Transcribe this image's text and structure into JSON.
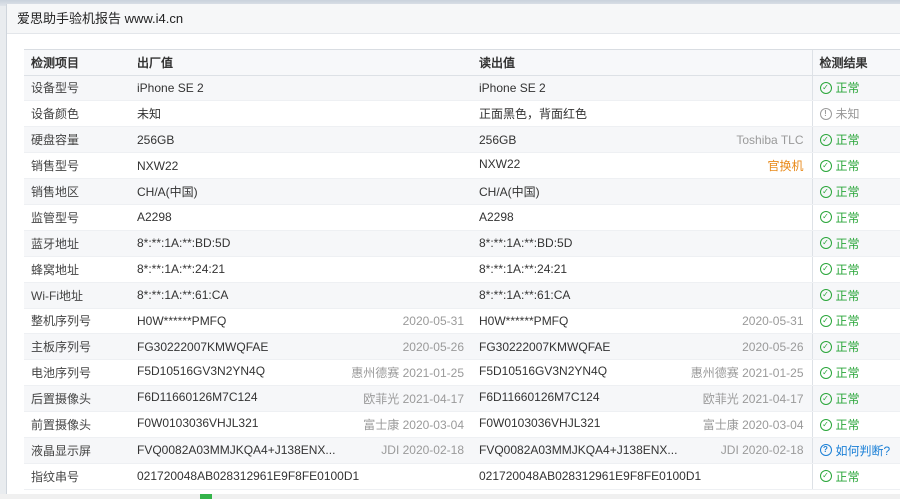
{
  "window": {
    "title": "爱思助手验机报告 www.i4.cn"
  },
  "table": {
    "headers": [
      "检测项目",
      "出厂值",
      "读出值",
      "检测结果"
    ],
    "rows": [
      {
        "item": "设备型号",
        "factory": "iPhone SE 2",
        "factory_note": "",
        "read": "iPhone SE 2",
        "read_note": "",
        "read_note_warn": false,
        "result": "正常",
        "result_type": "ok"
      },
      {
        "item": "设备颜色",
        "factory": "未知",
        "factory_note": "",
        "read": "正面黑色，背面红色",
        "read_note": "",
        "read_note_warn": false,
        "result": "未知",
        "result_type": "unknown"
      },
      {
        "item": "硬盘容量",
        "factory": "256GB",
        "factory_note": "",
        "read": "256GB",
        "read_note": "Toshiba TLC",
        "read_note_warn": false,
        "result": "正常",
        "result_type": "ok"
      },
      {
        "item": "销售型号",
        "factory": "NXW22",
        "factory_note": "",
        "read": "NXW22",
        "read_note": "官换机",
        "read_note_warn": true,
        "result": "正常",
        "result_type": "ok"
      },
      {
        "item": "销售地区",
        "factory": "CH/A(中国)",
        "factory_note": "",
        "read": "CH/A(中国)",
        "read_note": "",
        "read_note_warn": false,
        "result": "正常",
        "result_type": "ok"
      },
      {
        "item": "监管型号",
        "factory": "A2298",
        "factory_note": "",
        "read": "A2298",
        "read_note": "",
        "read_note_warn": false,
        "result": "正常",
        "result_type": "ok"
      },
      {
        "item": "蓝牙地址",
        "factory": "8*:**:1A:**:BD:5D",
        "factory_note": "",
        "read": "8*:**:1A:**:BD:5D",
        "read_note": "",
        "read_note_warn": false,
        "result": "正常",
        "result_type": "ok"
      },
      {
        "item": "蜂窝地址",
        "factory": "8*:**:1A:**:24:21",
        "factory_note": "",
        "read": "8*:**:1A:**:24:21",
        "read_note": "",
        "read_note_warn": false,
        "result": "正常",
        "result_type": "ok"
      },
      {
        "item": "Wi-Fi地址",
        "factory": "8*:**:1A:**:61:CA",
        "factory_note": "",
        "read": "8*:**:1A:**:61:CA",
        "read_note": "",
        "read_note_warn": false,
        "result": "正常",
        "result_type": "ok"
      },
      {
        "item": "整机序列号",
        "factory": "H0W******PMFQ",
        "factory_note": "2020-05-31",
        "read": "H0W******PMFQ",
        "read_note": "2020-05-31",
        "read_note_warn": false,
        "result": "正常",
        "result_type": "ok"
      },
      {
        "item": "主板序列号",
        "factory": "FG30222007KMWQFAE",
        "factory_note": "2020-05-26",
        "read": "FG30222007KMWQFAE",
        "read_note": "2020-05-26",
        "read_note_warn": false,
        "result": "正常",
        "result_type": "ok"
      },
      {
        "item": "电池序列号",
        "factory": "F5D10516GV3N2YN4Q",
        "factory_note": "惠州德赛 2021-01-25",
        "read": "F5D10516GV3N2YN4Q",
        "read_note": "惠州德赛 2021-01-25",
        "read_note_warn": false,
        "result": "正常",
        "result_type": "ok"
      },
      {
        "item": "后置摄像头",
        "factory": "F6D11660126M7C124",
        "factory_note": "欧菲光 2021-04-17",
        "read": "F6D11660126M7C124",
        "read_note": "欧菲光 2021-04-17",
        "read_note_warn": false,
        "result": "正常",
        "result_type": "ok"
      },
      {
        "item": "前置摄像头",
        "factory": "F0W0103036VHJL321",
        "factory_note": "富士康 2020-03-04",
        "read": "F0W0103036VHJL321",
        "read_note": "富士康 2020-03-04",
        "read_note_warn": false,
        "result": "正常",
        "result_type": "ok"
      },
      {
        "item": "液晶显示屏",
        "factory": "FVQ0082A03MMJKQA4+J138ENX...",
        "factory_note": "JDI 2020-02-18",
        "read": "FVQ0082A03MMJKQA4+J138ENX...",
        "read_note": "JDI 2020-02-18",
        "read_note_warn": false,
        "result": "如何判断?",
        "result_type": "help"
      },
      {
        "item": "指纹串号",
        "factory": "021720048AB028312961E9F8FE0100D1",
        "factory_note": "",
        "read": "021720048AB028312961E9F8FE0100D1",
        "read_note": "",
        "read_note_warn": false,
        "result": "正常",
        "result_type": "ok"
      }
    ]
  },
  "icons": {
    "ok": "check-circle-icon",
    "unknown": "exclamation-circle-icon",
    "help": "question-circle-icon"
  },
  "colors": {
    "ok": "#2aa63a",
    "warn": "#e88a1a",
    "help": "#1a7fd6",
    "muted": "#9a9a9a"
  }
}
